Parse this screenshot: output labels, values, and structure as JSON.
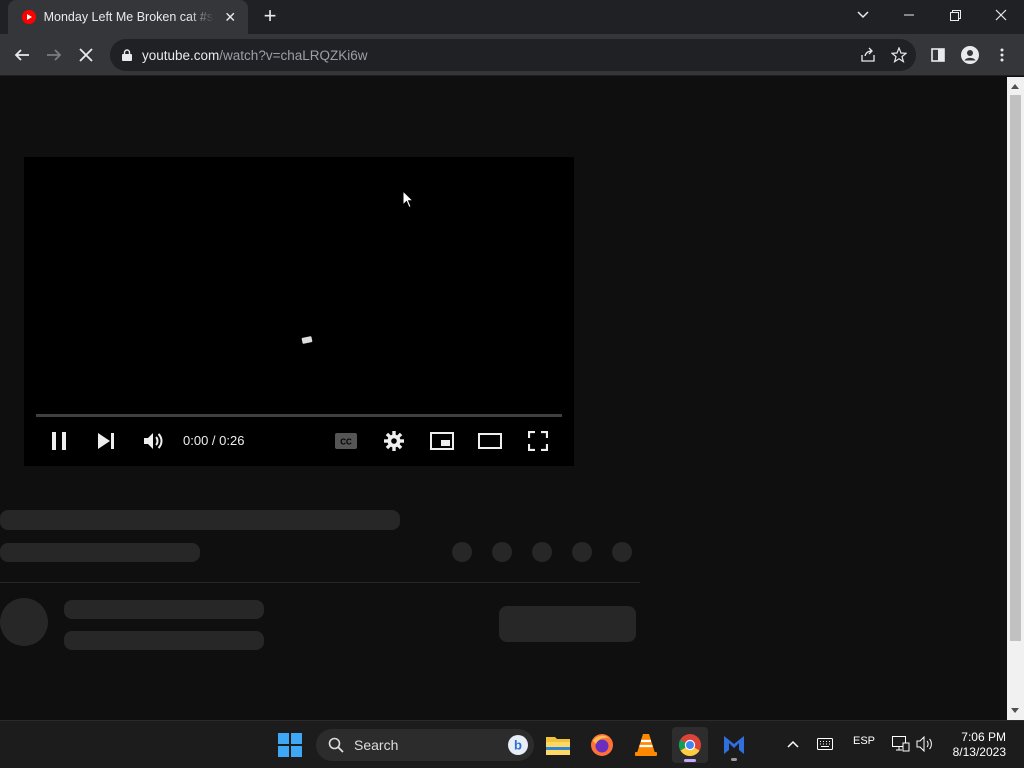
{
  "browser": {
    "tab_title": "Monday Left Me Broken cat #shorts",
    "url_host": "youtube.com",
    "url_path": "/watch?v=chaLRQZKi6w"
  },
  "player": {
    "current_time": "0:00",
    "separator": " / ",
    "duration": "0:26",
    "progress_fraction": 0
  },
  "taskbar": {
    "search_label": "Search",
    "language": "ESP",
    "time": "7:06 PM",
    "date": "8/13/2023"
  },
  "colors": {
    "youtube_red": "#ff0000",
    "page_bg": "#0f0f0f",
    "skeleton": "#272727"
  }
}
